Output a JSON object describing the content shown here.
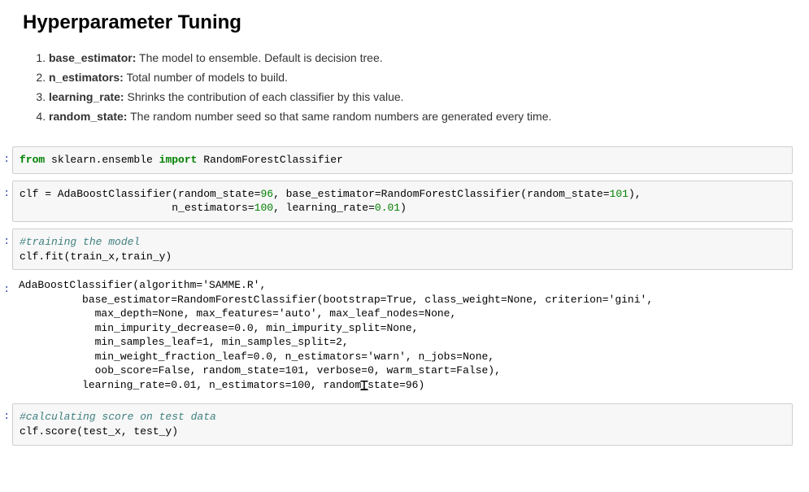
{
  "title": "Hyperparameter Tuning",
  "params": [
    {
      "name": "base_estimator:",
      "desc": " The model to ensemble. Default is decision tree."
    },
    {
      "name": "n_estimators:",
      "desc": " Total number of models to build."
    },
    {
      "name": "learning_rate:",
      "desc": " Shrinks the contribution of each classifier by this value."
    },
    {
      "name": "random_state:",
      "desc": " The random number seed so that same random numbers are generated every time."
    }
  ],
  "prompt_char": ":",
  "cells": {
    "c1": {
      "kw_from": "from",
      "mod": " sklearn.ensemble ",
      "kw_import": "import",
      "name": " RandomForestClassifier"
    },
    "c2": {
      "line1a": "clf = AdaBoostClassifier(random_state=",
      "num96": "96",
      "line1b": ", base_estimator=RandomForestClassifier(random_state=",
      "num101": "101",
      "line1c": "),",
      "line2a": "                        n_estimators=",
      "num100": "100",
      "line2b": ", learning_rate=",
      "num001": "0.01",
      "line2c": ")"
    },
    "c3": {
      "comment": "#training the model",
      "code": "clf.fit(train_x,train_y)"
    },
    "out3": "AdaBoostClassifier(algorithm='SAMME.R',\n          base_estimator=RandomForestClassifier(bootstrap=True, class_weight=None, criterion='gini',\n            max_depth=None, max_features='auto', max_leaf_nodes=None,\n            min_impurity_decrease=0.0, min_impurity_split=None,\n            min_samples_leaf=1, min_samples_split=2,\n            min_weight_fraction_leaf=0.0, n_estimators='warn', n_jobs=None,\n            oob_score=False, random_state=101, verbose=0, warm_start=False),\n          learning_rate=0.01, n_estimators=100, random_state=96)",
    "c4": {
      "comment": "#calculating score on test data",
      "code": "clf.score(test_x, test_y)"
    }
  }
}
